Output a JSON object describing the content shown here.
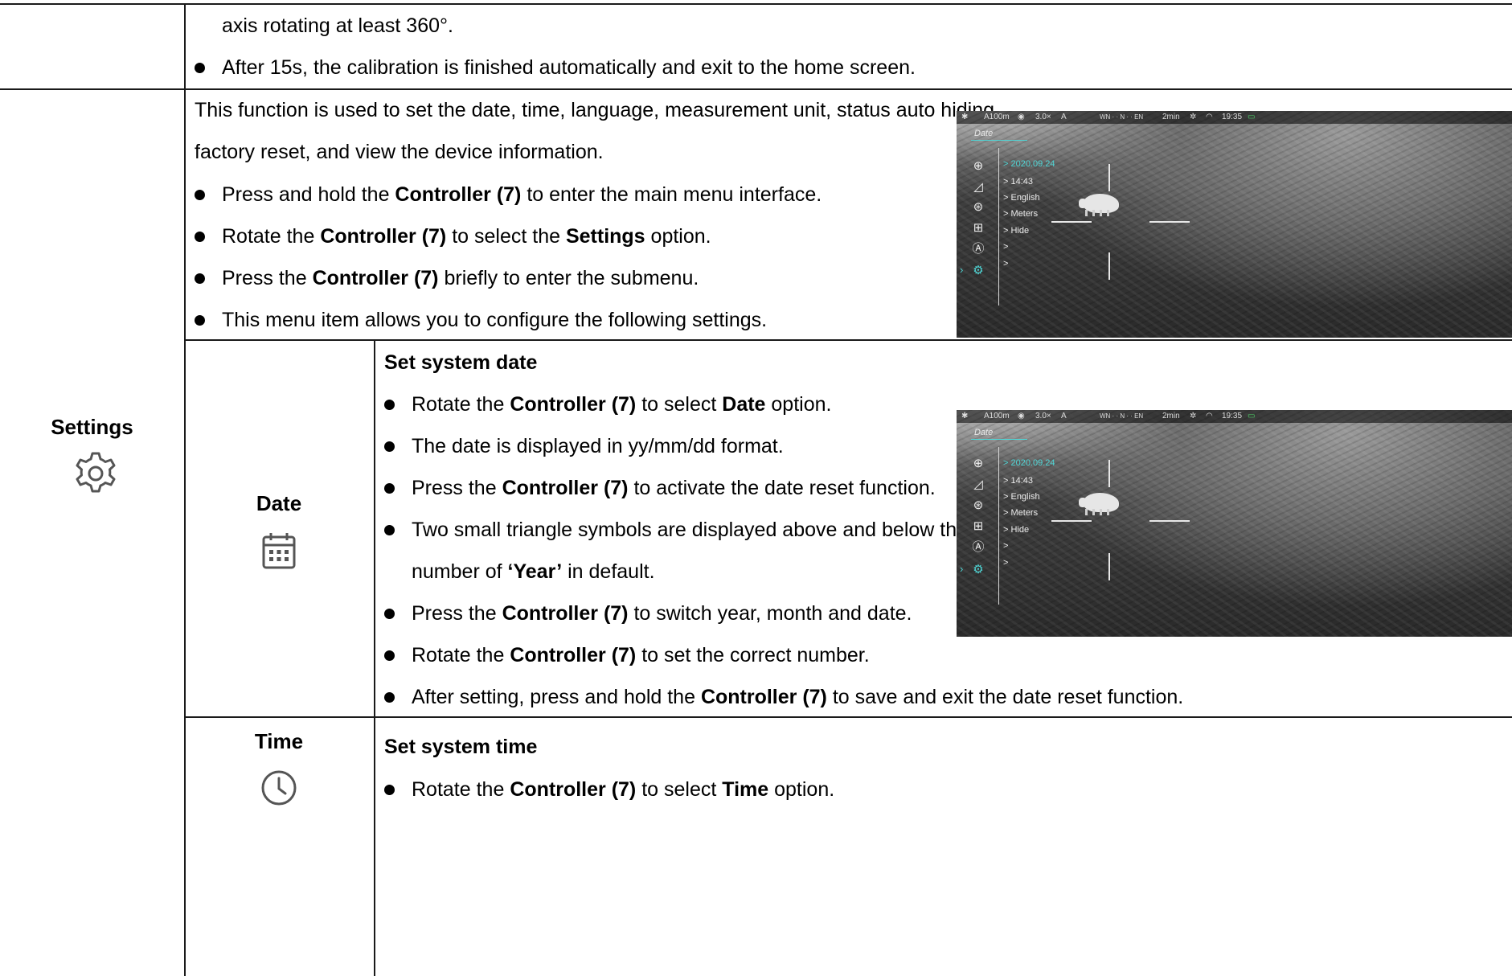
{
  "rows": {
    "prev": {
      "line1": "axis rotating at least 360°.",
      "line2": "After 15s, the calibration is finished automatically and exit to the home screen."
    },
    "settings": {
      "label": "Settings",
      "icon": "gear-icon",
      "intro1": "This function is used to set the date, time, language, measurement unit, status auto hiding,",
      "intro2": "factory reset, and view the device information.",
      "bullets": [
        {
          "pre": "Press and hold the ",
          "b1": "Controller (7)",
          "mid": " to enter the main menu interface.",
          "b2": "",
          "post": ""
        },
        {
          "pre": "Rotate the ",
          "b1": "Controller (7)",
          "mid": " to select the ",
          "b2": "Settings",
          "post": " option."
        },
        {
          "pre": "Press the ",
          "b1": "Controller (7)",
          "mid": " briefly to enter the submenu.",
          "b2": "",
          "post": ""
        },
        {
          "pre": "This menu item allows you to configure the following settings.",
          "b1": "",
          "mid": "",
          "b2": "",
          "post": ""
        }
      ]
    },
    "date": {
      "label": "Date",
      "icon": "calendar-icon",
      "heading": "Set system date",
      "b1": {
        "pre": "Rotate the ",
        "b1": "Controller (7)",
        "mid": " to select ",
        "b2": "Date",
        "post": " option."
      },
      "b2": {
        "text": "The date is displayed in yy/mm/dd format."
      },
      "b3": {
        "pre": "Press the ",
        "b1": "Controller (7)",
        "post": " to activate the date reset function."
      },
      "b4": {
        "line1": "Two small triangle symbols are displayed above and below the",
        "pre": "number of ",
        "b1": "‘Year’",
        "post": " in default."
      },
      "b5": {
        "pre": "Press the ",
        "b1": "Controller (7)",
        "post": " to switch year, month and date."
      },
      "b6": {
        "pre": "Rotate the ",
        "b1": "Controller (7)",
        "post": " to set the correct number."
      },
      "b7": {
        "pre": "After setting, press and hold the ",
        "b1": "Controller (7)",
        "post": " to save and exit the date reset function."
      }
    },
    "time": {
      "label": "Time",
      "icon": "clock-icon",
      "heading": "Set system time",
      "b1": {
        "pre": "Rotate the ",
        "b1": "Controller (7)",
        "mid": " to select ",
        "b2": "Time",
        "post": " option."
      }
    }
  },
  "screenshot": {
    "status": {
      "range": "A100m",
      "zoom": "3.0×",
      "mode": "A",
      "compass": "WN · · N · · EN",
      "timer": "2min",
      "clock": "19:35"
    },
    "title": "Date",
    "items": [
      "> 2020.09.24",
      "> 14:43",
      "> English",
      "> Meters",
      "> Hide",
      ">",
      ">"
    ],
    "icons": [
      "crosshair-icon",
      "display-icon",
      "palette-icon",
      "pip-icon",
      "compass-icon",
      "settings-icon"
    ]
  }
}
